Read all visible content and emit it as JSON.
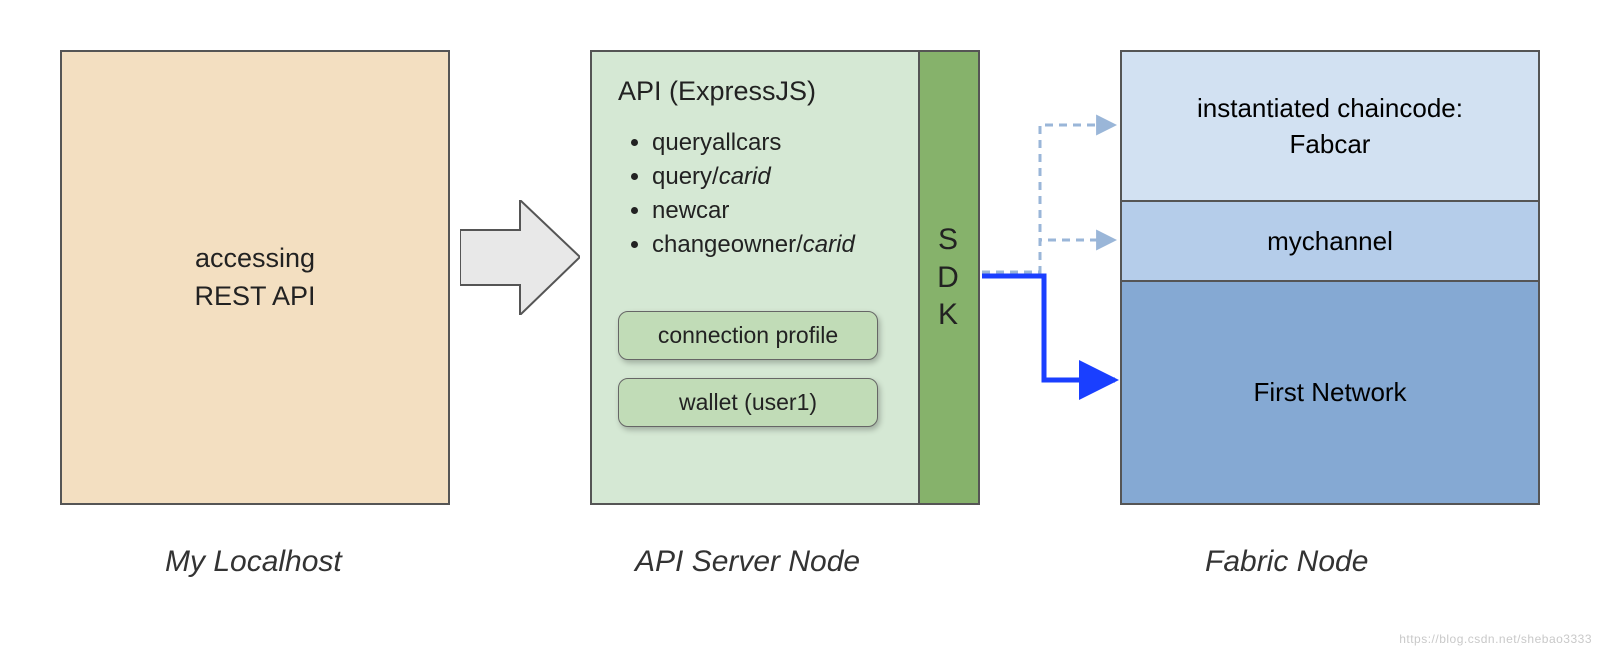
{
  "localhost": {
    "line1": "accessing",
    "line2": "REST API",
    "caption": "My Localhost"
  },
  "apiServer": {
    "title": "API (ExpressJS)",
    "endpoints": {
      "e0": "queryallcars",
      "e1_pre": "query/",
      "e1_param": "carid",
      "e2": "newcar",
      "e3_pre": "changeowner/",
      "e3_param": "carid"
    },
    "chip1": "connection profile",
    "chip2": "wallet (user1)",
    "sdk": "SDK",
    "caption": "API Server Node"
  },
  "fabric": {
    "top_line1": "instantiated chaincode:",
    "top_line2": "Fabcar",
    "mid": "mychannel",
    "bot": "First Network",
    "caption": "Fabric Node"
  },
  "watermark": "https://blog.csdn.net/shebao3333",
  "colors": {
    "localhost_bg": "#f3dfc1",
    "api_bg": "#d5e8d4",
    "sdk_bg": "#86b26b",
    "chip_bg": "#c1dcb7",
    "fabric_top": "#d2e1f2",
    "fabric_mid": "#b5cdea",
    "fabric_bot": "#85a9d3",
    "arrow_fill": "#e8e8e8",
    "solid_blue": "#1a3fff",
    "dashed_blue": "#9ab6d8"
  }
}
